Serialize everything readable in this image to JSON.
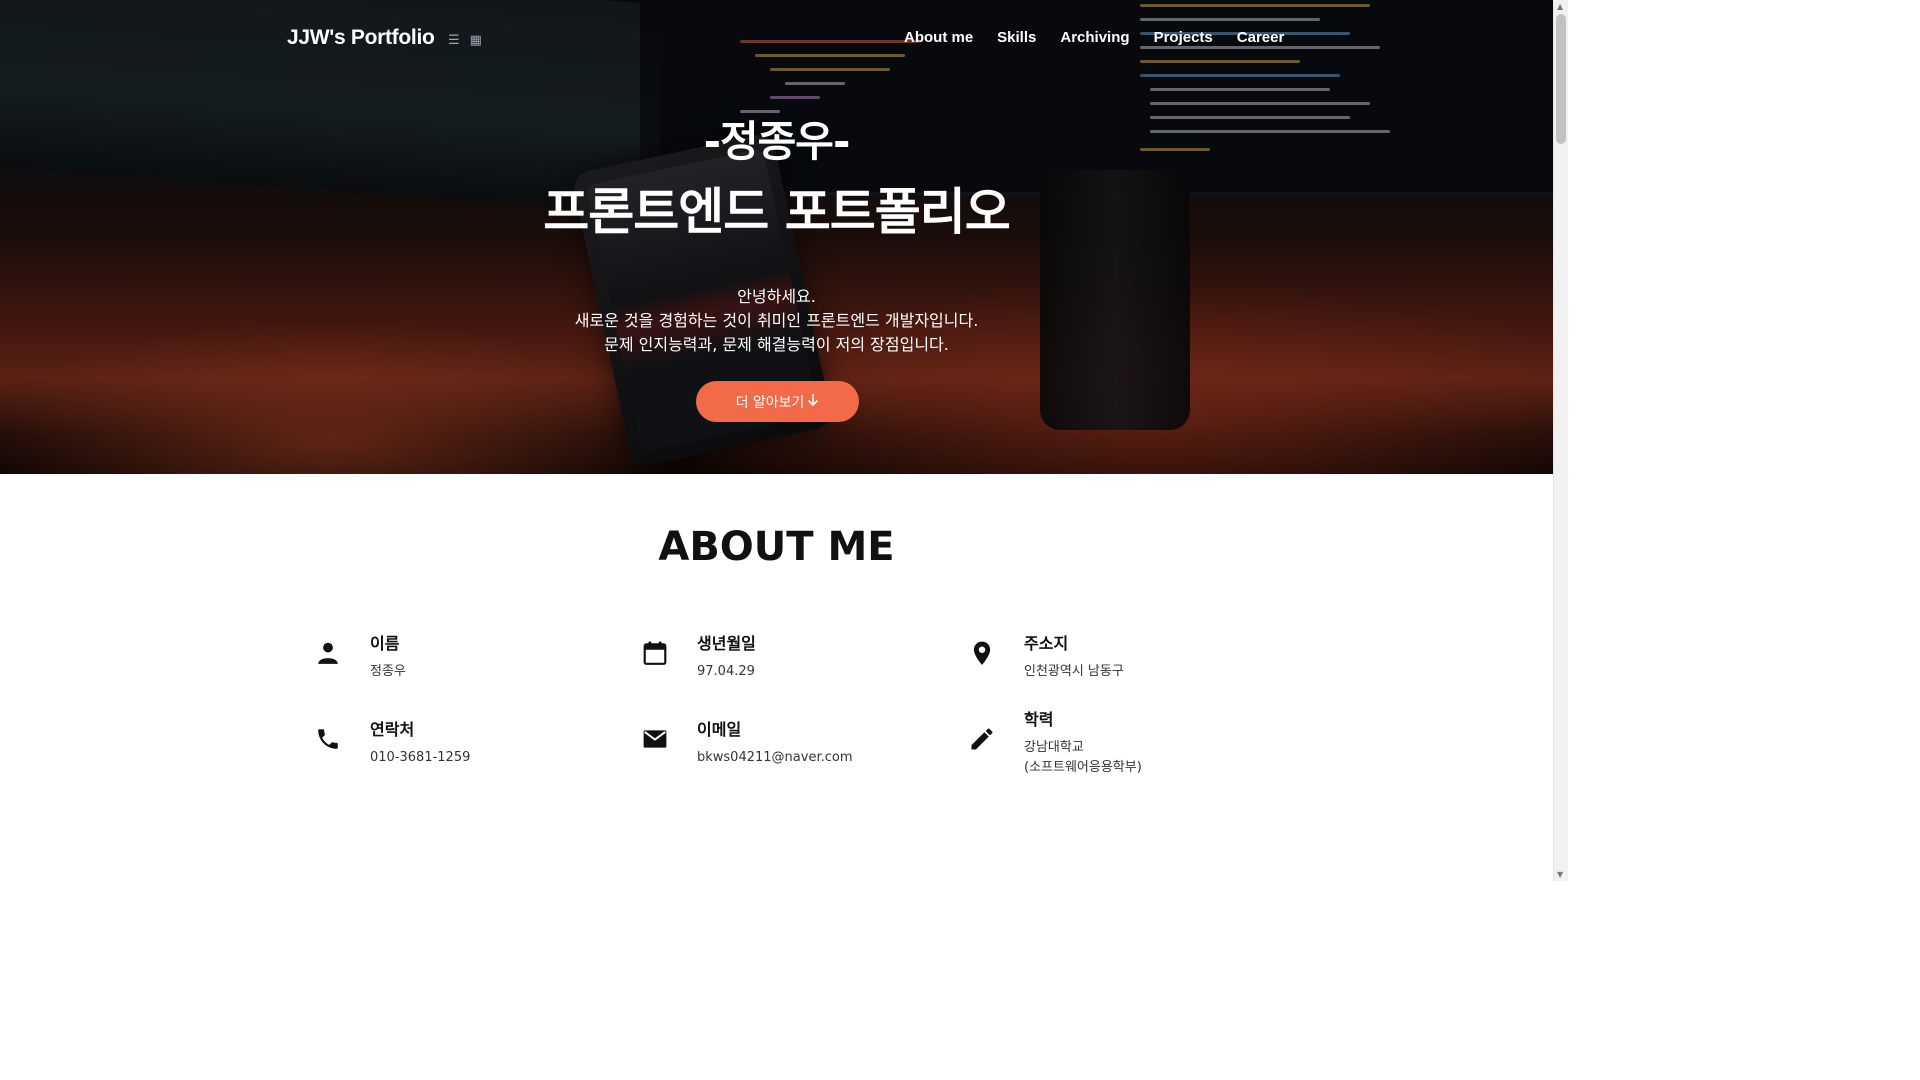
{
  "header": {
    "brand": "JJW's Portfolio",
    "icons": [
      "list-icon",
      "grid-icon"
    ],
    "nav": [
      {
        "label": "About me"
      },
      {
        "label": "Skills"
      },
      {
        "label": "Archiving"
      },
      {
        "label": "Projects"
      },
      {
        "label": "Career"
      }
    ]
  },
  "hero": {
    "name": "-정종우-",
    "title": "프론트엔드 포트폴리오",
    "description": [
      "안녕하세요.",
      "새로운 것을 경험하는 것이 취미인 프론트엔드 개발자입니다.",
      "문제 인지능력과, 문제 해결능력이 저의 장점입니다."
    ],
    "cta_label": "더 알아보기",
    "cta_icon": "arrow-down-icon"
  },
  "about": {
    "title": "ABOUT ME",
    "items": [
      {
        "icon": "person-icon",
        "label": "이름",
        "value": "정종우"
      },
      {
        "icon": "calendar-icon",
        "label": "생년월일",
        "value": "97.04.29"
      },
      {
        "icon": "location-icon",
        "label": "주소지",
        "value": "인천광역시 남동구"
      },
      {
        "icon": "phone-icon",
        "label": "연락처",
        "value": "010-3681-1259"
      },
      {
        "icon": "email-icon",
        "label": "이메일",
        "value": "bkws04211@naver.com"
      },
      {
        "icon": "pencil-icon",
        "label": "학력",
        "value": "강남대학교",
        "value2": "(소프트웨어응용학부)"
      }
    ]
  },
  "colors": {
    "accent": "#f26a48",
    "text": "#111111"
  }
}
